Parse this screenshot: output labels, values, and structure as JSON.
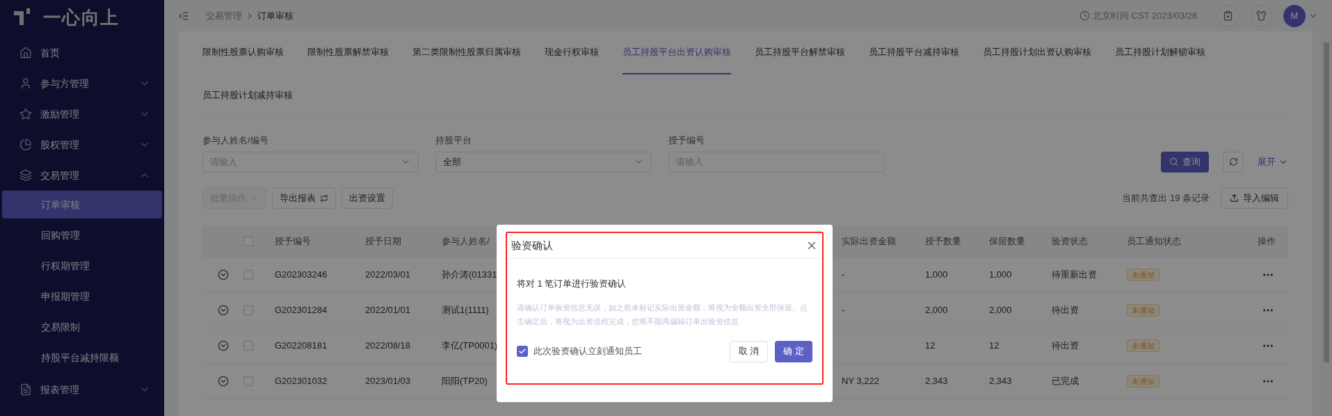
{
  "sidebar": {
    "logo": "一心向上",
    "items": [
      {
        "label": "首页"
      },
      {
        "label": "参与方管理",
        "expanded": false
      },
      {
        "label": "激励管理",
        "expanded": false
      },
      {
        "label": "股权管理",
        "expanded": false
      },
      {
        "label": "交易管理",
        "expanded": true,
        "children": [
          {
            "label": "订单审核",
            "selected": true
          },
          {
            "label": "回购管理",
            "selected": false
          },
          {
            "label": "行权期管理",
            "selected": false
          },
          {
            "label": "申报期管理",
            "selected": false
          },
          {
            "label": "交易限制",
            "selected": false
          },
          {
            "label": "持股平台减持限额",
            "selected": false
          }
        ]
      },
      {
        "label": "报表管理",
        "expanded": false
      }
    ]
  },
  "header": {
    "breadcrumb": [
      "交易管理",
      "订单审核"
    ],
    "time": "北京时间 CST 2023/03/28",
    "avatar": "M"
  },
  "tabs": [
    {
      "label": "限制性股票认购审核",
      "selected": false
    },
    {
      "label": "限制性股票解禁审核",
      "selected": false
    },
    {
      "label": "第二类限制性股票归属审核",
      "selected": false
    },
    {
      "label": "现金行权审核",
      "selected": false
    },
    {
      "label": "员工持股平台出资认购审核",
      "selected": true
    },
    {
      "label": "员工持股平台解禁审核",
      "selected": false
    },
    {
      "label": "员工持股平台减持审核",
      "selected": false
    },
    {
      "label": "员工持股计划出资认购审核",
      "selected": false
    },
    {
      "label": "员工持股计划解锁审核",
      "selected": false
    },
    {
      "label": "员工持股计划减持审核",
      "selected": false
    }
  ],
  "filters": [
    {
      "label": "参与人姓名/编号",
      "kind": "select",
      "placeholder": "请输入"
    },
    {
      "label": "持股平台",
      "kind": "select",
      "value": "全部"
    },
    {
      "label": "授予编号",
      "kind": "input",
      "placeholder": "请输入"
    }
  ],
  "query_button": "查询",
  "expand_link": "展开",
  "toolbar": [
    {
      "label": "批量操作",
      "kind": "dropdown",
      "disabled": true
    },
    {
      "label": "导出报表",
      "kind": "export",
      "disabled": false
    },
    {
      "label": "出资设置",
      "kind": "plain",
      "disabled": false
    }
  ],
  "record_count": "当前共查出 19 条记录",
  "import_button": "导入编辑",
  "table": {
    "header_checked": false,
    "columns": [
      "授予编号",
      "授予日期",
      "参与人姓名/",
      "实际出资金额",
      "授予数量",
      "保留数量",
      "验资状态",
      "员工通知状态",
      "操作"
    ],
    "rows": [
      {
        "code": "G202303246",
        "date": "2022/03/01",
        "participant": "孙介涛(01331",
        "amount": "-",
        "quantity": "1,000",
        "retained": "1,000",
        "status": "待重新出资",
        "notice": "未通知",
        "checked": false
      },
      {
        "code": "G202301284",
        "date": "2022/01/01",
        "participant": "测试1(1111)",
        "amount": "-",
        "quantity": "2,000",
        "retained": "2,000",
        "status": "待出资",
        "notice": "未通知",
        "checked": false
      },
      {
        "code": "G202208181",
        "date": "2022/08/18",
        "participant": "李亿(TP0001)",
        "quantity": "12",
        "retained": "12",
        "status": "待出资",
        "notice": "未通知",
        "checked": false
      },
      {
        "code": "G202301032",
        "date": "2023/01/03",
        "participant": "阳阳(TP20)",
        "amount": "NY 3,222",
        "quantity": "2,343",
        "retained": "2,343",
        "status": "已完成",
        "notice": "未通知",
        "checked": false
      }
    ]
  },
  "modal": {
    "title": "验资确认",
    "message": "将对 1 笔订单进行验资确认",
    "note": "请确认订单验资信息无误，如之前未标记实际出资金额，将视为全额出资全部保留。点击确定后，将视为出资流程完成，您将不能再编辑订单出验资信息",
    "notify": {
      "label": "此次验资确认立刻通知员工",
      "checked": true
    },
    "cancel": "取 消",
    "confirm": "确 定"
  }
}
